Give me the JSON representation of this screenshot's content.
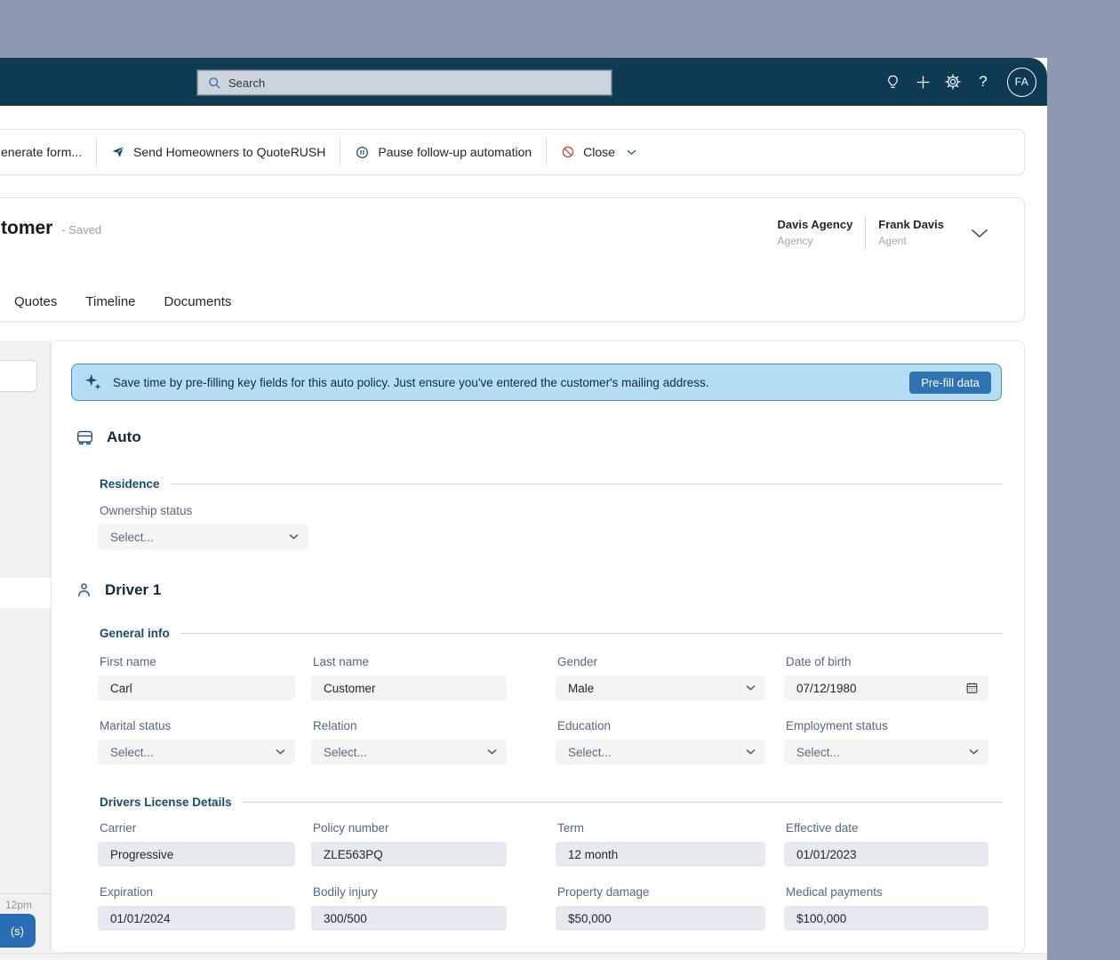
{
  "colors": {
    "desktop_bg": "#8d99b1",
    "header_bg": "#0e3a53",
    "accent_blue": "#2e74b5",
    "banner_bg": "#b5def4",
    "icon_navy": "#1c4b70",
    "close_red": "#c23b3b"
  },
  "header": {
    "search_placeholder": "Search",
    "avatar_initials": "FA"
  },
  "toolbar": {
    "generate_form_fragment": "enerate form...",
    "send_label": "Send Homeowners to QuoteRUSH",
    "pause_label": "Pause follow-up automation",
    "close_label": "Close"
  },
  "record": {
    "title_fragment": "tomer",
    "save_status": "- Saved",
    "assignment": {
      "agency_name": "Davis Agency",
      "agency_role": "Agency",
      "agent_name": "Frank Davis",
      "agent_role": "Agent"
    },
    "tabs": [
      {
        "label": "Quotes"
      },
      {
        "label": "Timeline"
      },
      {
        "label": "Documents"
      }
    ]
  },
  "left_panel": {
    "time_label": "12pm",
    "button_fragment": "(s)"
  },
  "prefill_banner": {
    "message": "Save time by pre-filling key fields for this auto policy. Just ensure you've entered the customer's mailing address.",
    "button": "Pre-fill data"
  },
  "policy_form": {
    "auto": {
      "heading": "Auto",
      "residence": {
        "section": "Residence",
        "ownership": {
          "label": "Ownership status",
          "value": "Select..."
        }
      }
    },
    "driver": {
      "heading": "Driver 1",
      "general": {
        "section": "General info",
        "fields": [
          {
            "label": "First name",
            "value": "Carl"
          },
          {
            "label": "Last name",
            "value": "Customer"
          },
          {
            "label": "Gender",
            "value": "Male"
          },
          {
            "label": "Date of birth",
            "value": "07/12/1980"
          },
          {
            "label": "Marital status",
            "value": "Select..."
          },
          {
            "label": "Relation",
            "value": "Select..."
          },
          {
            "label": "Education",
            "value": "Select..."
          },
          {
            "label": "Employment status",
            "value": "Select..."
          }
        ]
      },
      "license": {
        "section": "Drivers License Details",
        "fields": [
          {
            "label": "Carrier",
            "value": "Progressive"
          },
          {
            "label": "Policy number",
            "value": "ZLE563PQ"
          },
          {
            "label": "Term",
            "value": "12 month"
          },
          {
            "label": "Effective date",
            "value": "01/01/2023"
          },
          {
            "label": "Expiration",
            "value": "01/01/2024"
          },
          {
            "label": "Bodily injury",
            "value": "300/500"
          },
          {
            "label": "Property damage",
            "value": "$50,000"
          },
          {
            "label": "Medical payments",
            "value": "$100,000"
          }
        ]
      }
    }
  }
}
